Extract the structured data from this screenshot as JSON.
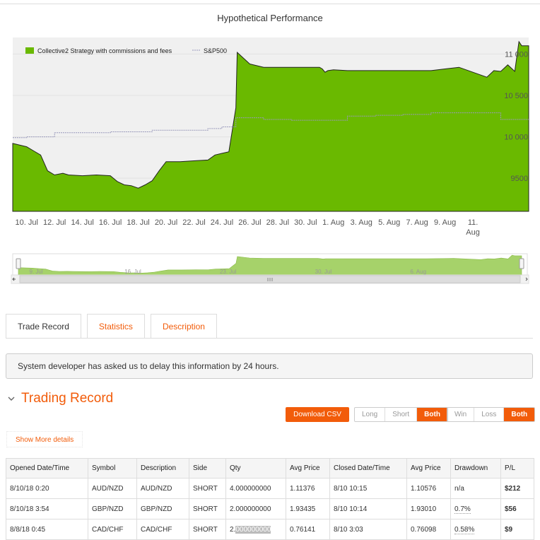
{
  "chart_data": {
    "type": "area",
    "title": "Hypothetical Performance",
    "legend_placement": "top-left",
    "series": [
      {
        "name": "Collective2 Strategy with commissions and fees",
        "color": "#6ab900",
        "kind": "area",
        "x": [
          0,
          1,
          1.5,
          2,
          2.5,
          3,
          3.6,
          4,
          5,
          6,
          7,
          7.5,
          8,
          8.5,
          9,
          9.5,
          10,
          10.5,
          11,
          12,
          13,
          14,
          14.5,
          15,
          15.5,
          16,
          16.1,
          17,
          18,
          19,
          20,
          21,
          21.8,
          22,
          22.2,
          22.4,
          22.6,
          23,
          24,
          26,
          28,
          30,
          32,
          34,
          34.5,
          35,
          35.5,
          36,
          36.3,
          36.5,
          37
        ],
        "y": [
          9920,
          9880,
          9830,
          9780,
          9590,
          9540,
          9560,
          9540,
          9530,
          9540,
          9530,
          9460,
          9420,
          9410,
          9380,
          9420,
          9470,
          9590,
          9700,
          9700,
          9710,
          9720,
          9780,
          9800,
          9820,
          10350,
          11020,
          10880,
          10840,
          10840,
          10840,
          10840,
          10840,
          10840,
          10820,
          10780,
          10800,
          10810,
          10800,
          10800,
          10800,
          10800,
          10840,
          10720,
          10800,
          10790,
          10870,
          10790,
          11150,
          11100,
          11100
        ]
      },
      {
        "name": "S&P500",
        "color": "#9999bb",
        "kind": "line",
        "x": [
          0,
          1,
          3,
          7,
          10,
          14,
          15,
          16,
          18,
          20,
          22,
          24,
          26,
          28,
          30,
          32,
          34,
          35,
          36,
          37
        ],
        "y": [
          9990,
          10000,
          10050,
          10060,
          10080,
          10100,
          10120,
          10230,
          10210,
          10200,
          10200,
          10250,
          10260,
          10270,
          10290,
          10290,
          10290,
          10210,
          10210,
          10210
        ]
      }
    ],
    "x_tick_labels": [
      "10. Jul",
      "12. Jul",
      "14. Jul",
      "16. Jul",
      "18. Jul",
      "20. Jul",
      "22. Jul",
      "24. Jul",
      "26. Jul",
      "28. Jul",
      "30. Jul",
      "1. Aug",
      "3. Aug",
      "5. Aug",
      "7. Aug",
      "9. Aug",
      "11. Aug"
    ],
    "x_tick_positions": [
      1,
      3,
      5,
      7,
      9,
      11,
      13,
      15,
      17,
      19,
      21,
      23,
      25,
      27,
      29,
      31,
      33
    ],
    "y_tick_labels": [
      "9500",
      "10 000",
      "10 500",
      "11 000"
    ],
    "y_tick_values": [
      9500,
      10000,
      10500,
      11000
    ],
    "xlim": [
      0,
      37
    ],
    "ylim": [
      9100,
      11200
    ],
    "grid": true,
    "navigator_labels": [
      "9. Jul",
      "16. Jul",
      "23. Jul",
      "30. Jul",
      "6. Aug"
    ]
  },
  "tabs": [
    {
      "label": "Trade Record",
      "active": true
    },
    {
      "label": "Statistics",
      "active": false
    },
    {
      "label": "Description",
      "active": false
    }
  ],
  "notice": "System developer has asked us to delay this information by 24 hours.",
  "section_title": "Trading Record",
  "download_label": "Download CSV",
  "side_filter": [
    "Long",
    "Short",
    "Both"
  ],
  "result_filter": [
    "Win",
    "Loss",
    "Both"
  ],
  "show_more_label": "Show More details",
  "table": {
    "headers": [
      "Opened Date/Time",
      "Symbol",
      "Description",
      "Side",
      "Qty",
      "Avg Price",
      "Closed Date/Time",
      "Avg Price",
      "Drawdown",
      "P/L"
    ],
    "rows": [
      [
        "8/10/18 0:20",
        "AUD/NZD",
        "AUD/NZD",
        "SHORT",
        "4.000000000",
        "1.11376",
        "8/10 10:15",
        "1.10576",
        "n/a",
        "$212"
      ],
      [
        "8/10/18 3:54",
        "GBP/NZD",
        "GBP/NZD",
        "SHORT",
        "2.000000000",
        "1.93435",
        "8/10 10:14",
        "1.93010",
        "0.7%",
        "$56"
      ],
      [
        "8/8/18 0:45",
        "CAD/CHF",
        "CAD/CHF",
        "SHORT",
        "2.000000000",
        "0.76141",
        "8/10 3:03",
        "0.76098",
        "0.58%",
        "$9"
      ]
    ]
  },
  "colors": {
    "accent": "#f25c0a",
    "area": "#6ab900",
    "profit": "#3a9a1a"
  }
}
